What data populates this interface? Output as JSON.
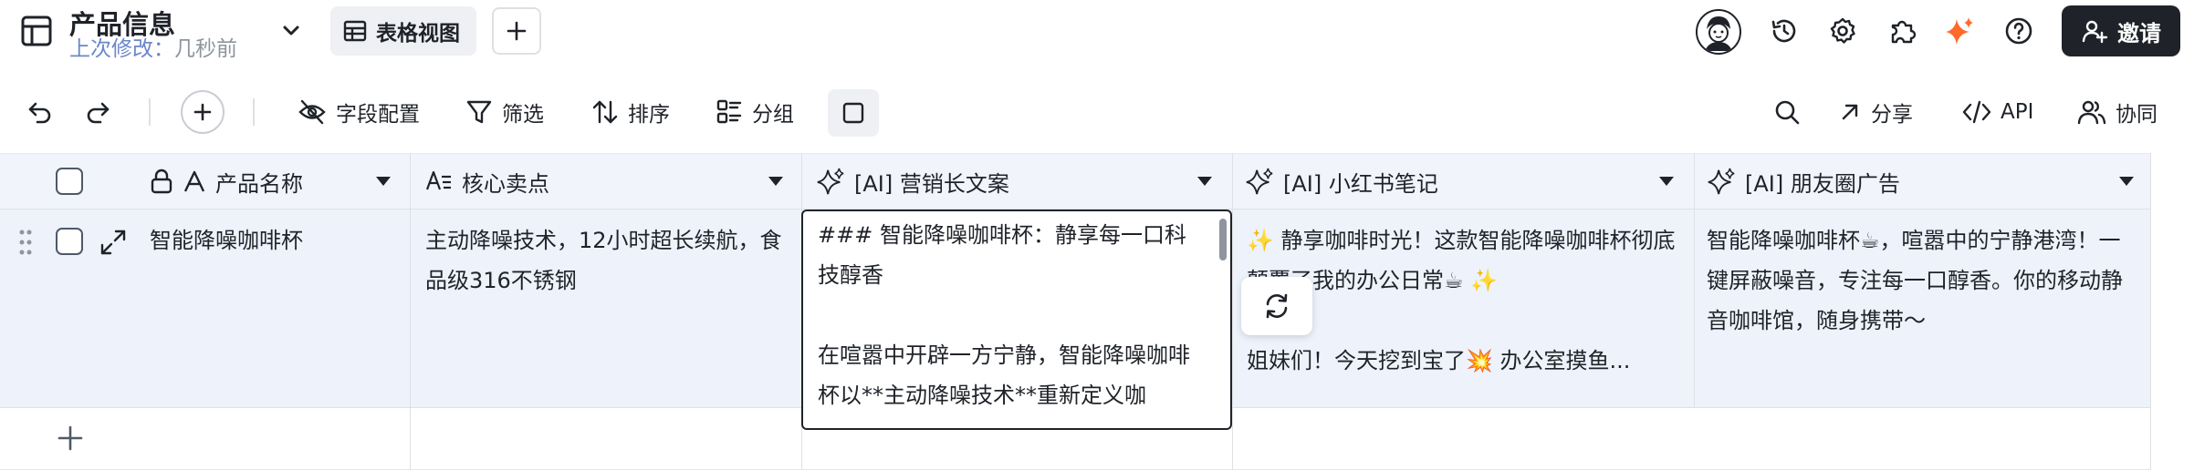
{
  "header": {
    "title": "产品信息",
    "subtitle_label": "上次修改：",
    "subtitle_value": "几秒前",
    "view_tab_label": "表格视图",
    "invite_label": "邀请",
    "ai_accent_color": "#ff6a2b"
  },
  "toolbar": {
    "field_config_label": "字段配置",
    "filter_label": "筛选",
    "sort_label": "排序",
    "group_label": "分组",
    "share_label": "分享",
    "api_label": "API",
    "collab_label": "协同"
  },
  "table": {
    "columns": [
      {
        "label": "产品名称",
        "icon": "text-field-icon"
      },
      {
        "label": "核心卖点",
        "icon": "long-text-field-icon"
      },
      {
        "label": "[AI] 营销长文案",
        "icon": "ai-sparkle-icon"
      },
      {
        "label": "[AI] 小红书笔记",
        "icon": "ai-sparkle-icon"
      },
      {
        "label": "[AI] 朋友圈广告",
        "icon": "ai-sparkle-icon"
      }
    ],
    "rows": [
      {
        "name": "智能降噪咖啡杯",
        "selling_points": "主动降噪技术，12小时超长续航，食品级316不锈钢",
        "long_copy": [
          "### 智能降噪咖啡杯：静享每一口科技醇香",
          "在喧嚣中开辟一方宁静，智能降噪咖啡杯以**主动降噪技术**重新定义咖"
        ],
        "xiaohongshu": [
          "✨ 静享咖啡时光！这款智能降噪咖啡杯彻底颠覆了我的办公日常☕ ✨",
          "姐妹们！今天挖到宝了💥 办公室摸鱼..."
        ],
        "moments": "智能降噪咖啡杯☕，喧嚣中的宁静港湾！一键屏蔽噪音，专注每一口醇香。你的移动静音咖啡馆，随身携带～"
      }
    ]
  }
}
